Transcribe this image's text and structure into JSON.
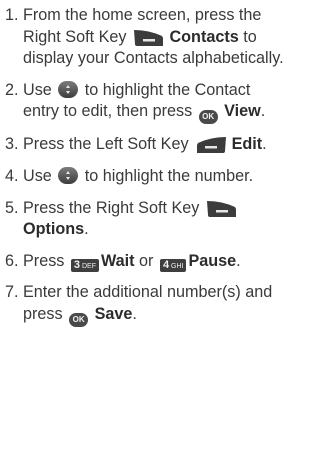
{
  "steps": [
    {
      "num": "1.",
      "pre": "From the home screen, press the Right Soft Key ",
      "bold": "Contacts",
      "post": " to display your Contacts alphabetically."
    },
    {
      "num": "2.",
      "pre": "Use ",
      "mid": " to highlight the Contact entry to edit, then press ",
      "bold": "View",
      "post": "."
    },
    {
      "num": "3.",
      "pre": "Press the Left Soft Key ",
      "bold": "Edit",
      "post": "."
    },
    {
      "num": "4.",
      "pre": "Use ",
      "post": " to highlight the number."
    },
    {
      "num": "5.",
      "pre": "Press the Right Soft Key ",
      "bold": "Options",
      "post": "."
    },
    {
      "num": "6.",
      "pre": "Press ",
      "bold": "Wait",
      "mid": " or ",
      "bold2": "Pause",
      "post": "."
    },
    {
      "num": "7.",
      "pre": "Enter the additional number(s) and press ",
      "bold": "Save",
      "post": "."
    }
  ],
  "icons": {
    "ok_label": "OK",
    "key3_digit": "3",
    "key3_letters": "DEF",
    "key4_digit": "4",
    "key4_letters": "GHI"
  }
}
